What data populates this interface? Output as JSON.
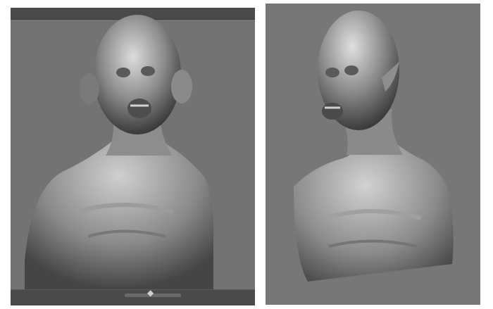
{
  "left_viewport": {
    "topbar_text": "",
    "bottom_arrow": "◆"
  },
  "right_viewport": {},
  "colors": {
    "viewport_bg_left": "#737373",
    "viewport_bg_right": "#777777",
    "toolbar": "#4a4a4a",
    "model_light": "#cfcfcf",
    "model_dark": "#3e3e3e"
  },
  "icons": {
    "left_model": "sculpt-bust-render",
    "right_model": "sculpt-bust-render"
  }
}
